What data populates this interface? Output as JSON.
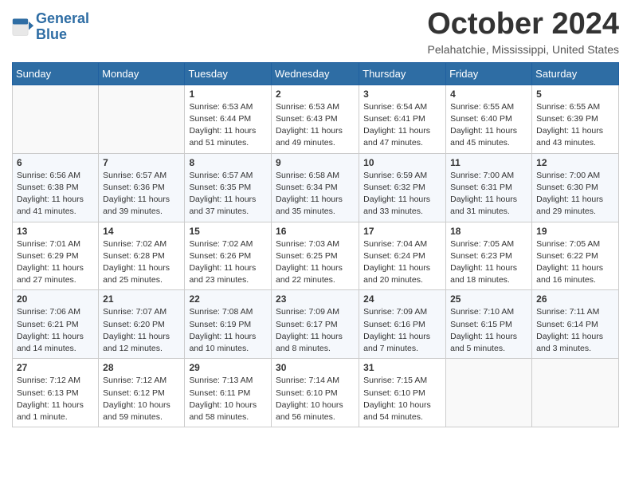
{
  "header": {
    "logo_line1": "General",
    "logo_line2": "Blue",
    "month": "October 2024",
    "location": "Pelahatchie, Mississippi, United States"
  },
  "weekdays": [
    "Sunday",
    "Monday",
    "Tuesday",
    "Wednesday",
    "Thursday",
    "Friday",
    "Saturday"
  ],
  "weeks": [
    [
      {
        "day": "",
        "info": ""
      },
      {
        "day": "",
        "info": ""
      },
      {
        "day": "1",
        "info": "Sunrise: 6:53 AM\nSunset: 6:44 PM\nDaylight: 11 hours and 51 minutes."
      },
      {
        "day": "2",
        "info": "Sunrise: 6:53 AM\nSunset: 6:43 PM\nDaylight: 11 hours and 49 minutes."
      },
      {
        "day": "3",
        "info": "Sunrise: 6:54 AM\nSunset: 6:41 PM\nDaylight: 11 hours and 47 minutes."
      },
      {
        "day": "4",
        "info": "Sunrise: 6:55 AM\nSunset: 6:40 PM\nDaylight: 11 hours and 45 minutes."
      },
      {
        "day": "5",
        "info": "Sunrise: 6:55 AM\nSunset: 6:39 PM\nDaylight: 11 hours and 43 minutes."
      }
    ],
    [
      {
        "day": "6",
        "info": "Sunrise: 6:56 AM\nSunset: 6:38 PM\nDaylight: 11 hours and 41 minutes."
      },
      {
        "day": "7",
        "info": "Sunrise: 6:57 AM\nSunset: 6:36 PM\nDaylight: 11 hours and 39 minutes."
      },
      {
        "day": "8",
        "info": "Sunrise: 6:57 AM\nSunset: 6:35 PM\nDaylight: 11 hours and 37 minutes."
      },
      {
        "day": "9",
        "info": "Sunrise: 6:58 AM\nSunset: 6:34 PM\nDaylight: 11 hours and 35 minutes."
      },
      {
        "day": "10",
        "info": "Sunrise: 6:59 AM\nSunset: 6:32 PM\nDaylight: 11 hours and 33 minutes."
      },
      {
        "day": "11",
        "info": "Sunrise: 7:00 AM\nSunset: 6:31 PM\nDaylight: 11 hours and 31 minutes."
      },
      {
        "day": "12",
        "info": "Sunrise: 7:00 AM\nSunset: 6:30 PM\nDaylight: 11 hours and 29 minutes."
      }
    ],
    [
      {
        "day": "13",
        "info": "Sunrise: 7:01 AM\nSunset: 6:29 PM\nDaylight: 11 hours and 27 minutes."
      },
      {
        "day": "14",
        "info": "Sunrise: 7:02 AM\nSunset: 6:28 PM\nDaylight: 11 hours and 25 minutes."
      },
      {
        "day": "15",
        "info": "Sunrise: 7:02 AM\nSunset: 6:26 PM\nDaylight: 11 hours and 23 minutes."
      },
      {
        "day": "16",
        "info": "Sunrise: 7:03 AM\nSunset: 6:25 PM\nDaylight: 11 hours and 22 minutes."
      },
      {
        "day": "17",
        "info": "Sunrise: 7:04 AM\nSunset: 6:24 PM\nDaylight: 11 hours and 20 minutes."
      },
      {
        "day": "18",
        "info": "Sunrise: 7:05 AM\nSunset: 6:23 PM\nDaylight: 11 hours and 18 minutes."
      },
      {
        "day": "19",
        "info": "Sunrise: 7:05 AM\nSunset: 6:22 PM\nDaylight: 11 hours and 16 minutes."
      }
    ],
    [
      {
        "day": "20",
        "info": "Sunrise: 7:06 AM\nSunset: 6:21 PM\nDaylight: 11 hours and 14 minutes."
      },
      {
        "day": "21",
        "info": "Sunrise: 7:07 AM\nSunset: 6:20 PM\nDaylight: 11 hours and 12 minutes."
      },
      {
        "day": "22",
        "info": "Sunrise: 7:08 AM\nSunset: 6:19 PM\nDaylight: 11 hours and 10 minutes."
      },
      {
        "day": "23",
        "info": "Sunrise: 7:09 AM\nSunset: 6:17 PM\nDaylight: 11 hours and 8 minutes."
      },
      {
        "day": "24",
        "info": "Sunrise: 7:09 AM\nSunset: 6:16 PM\nDaylight: 11 hours and 7 minutes."
      },
      {
        "day": "25",
        "info": "Sunrise: 7:10 AM\nSunset: 6:15 PM\nDaylight: 11 hours and 5 minutes."
      },
      {
        "day": "26",
        "info": "Sunrise: 7:11 AM\nSunset: 6:14 PM\nDaylight: 11 hours and 3 minutes."
      }
    ],
    [
      {
        "day": "27",
        "info": "Sunrise: 7:12 AM\nSunset: 6:13 PM\nDaylight: 11 hours and 1 minute."
      },
      {
        "day": "28",
        "info": "Sunrise: 7:12 AM\nSunset: 6:12 PM\nDaylight: 10 hours and 59 minutes."
      },
      {
        "day": "29",
        "info": "Sunrise: 7:13 AM\nSunset: 6:11 PM\nDaylight: 10 hours and 58 minutes."
      },
      {
        "day": "30",
        "info": "Sunrise: 7:14 AM\nSunset: 6:10 PM\nDaylight: 10 hours and 56 minutes."
      },
      {
        "day": "31",
        "info": "Sunrise: 7:15 AM\nSunset: 6:10 PM\nDaylight: 10 hours and 54 minutes."
      },
      {
        "day": "",
        "info": ""
      },
      {
        "day": "",
        "info": ""
      }
    ]
  ]
}
